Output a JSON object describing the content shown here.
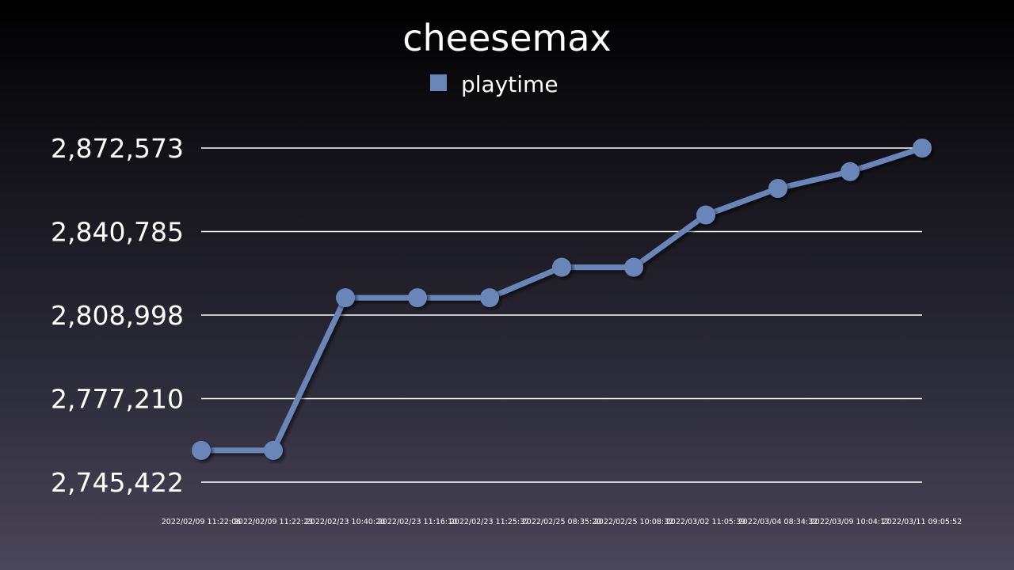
{
  "chart_data": {
    "type": "line",
    "title": "cheesemax",
    "legend_position": "top",
    "grid": true,
    "y_ticks": [
      "2,872,573",
      "2,840,785",
      "2,808,998",
      "2,777,210",
      "2,745,422"
    ],
    "ylim": [
      2745422,
      2872573
    ],
    "x": [
      "2022/02/09 11:22:06",
      "2022/02/09 11:22:23",
      "2022/02/23 10:40:20",
      "2022/02/23 11:16:10",
      "2022/02/23 11:25:37",
      "2022/02/25 08:35:20",
      "2022/02/25 10:08:32",
      "2022/03/02 11:05:39",
      "2022/03/04 08:34:32",
      "2022/03/09 10:04:17",
      "2022/03/11 09:05:52"
    ],
    "series": [
      {
        "name": "playtime",
        "color": "#6a86b8",
        "values": [
          2757500,
          2757500,
          2815600,
          2815600,
          2815600,
          2827200,
          2827200,
          2847100,
          2857200,
          2863600,
          2872573
        ]
      }
    ]
  }
}
